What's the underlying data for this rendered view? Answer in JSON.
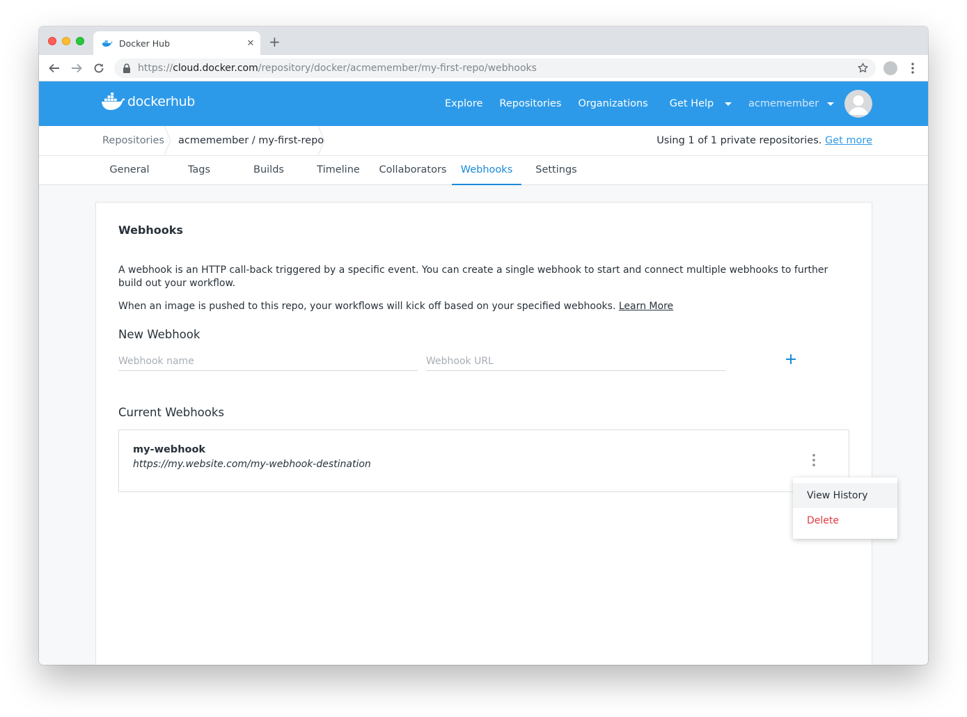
{
  "browser": {
    "tab_title": "Docker Hub",
    "url_scheme": "https://",
    "url_host": "cloud.docker.com",
    "url_path": "/repository/docker/acmemember/my-first-repo/webhooks"
  },
  "header": {
    "logo_docker": "docker",
    "logo_hub": "hub",
    "nav": {
      "explore": "Explore",
      "repositories": "Repositories",
      "organizations": "Organizations",
      "get_help": "Get Help"
    },
    "username": "acmemember"
  },
  "breadcrumb": {
    "root": "Repositories",
    "current": "acmemember / my-first-repo"
  },
  "quota": {
    "text": "Using 1 of 1 private repositories.",
    "link": "Get more"
  },
  "repo_tabs": {
    "general": "General",
    "tags": "Tags",
    "builds": "Builds",
    "timeline": "Timeline",
    "collaborators": "Collaborators",
    "webhooks": "Webhooks",
    "settings": "Settings"
  },
  "webhooks_page": {
    "title": "Webhooks",
    "description_1": "A webhook is an HTTP call-back triggered by a specific event. You can create a single webhook to start and connect multiple webhooks to further build out your workflow.",
    "description_2": "When an image is pushed to this repo, your workflows will kick off based on your specified webhooks.",
    "learn_more": "Learn More",
    "new_webhook_title": "New Webhook",
    "name_placeholder": "Webhook name",
    "url_placeholder": "Webhook URL",
    "current_title": "Current Webhooks",
    "webhooks": [
      {
        "name": "my-webhook",
        "url": "https://my.website.com/my-webhook-destination"
      }
    ]
  },
  "context_menu": {
    "view_history": "View History",
    "delete": "Delete"
  },
  "colors": {
    "brand_blue": "#2d9ae9",
    "active_tab": "#1a8ad9",
    "danger": "#e0393f"
  }
}
